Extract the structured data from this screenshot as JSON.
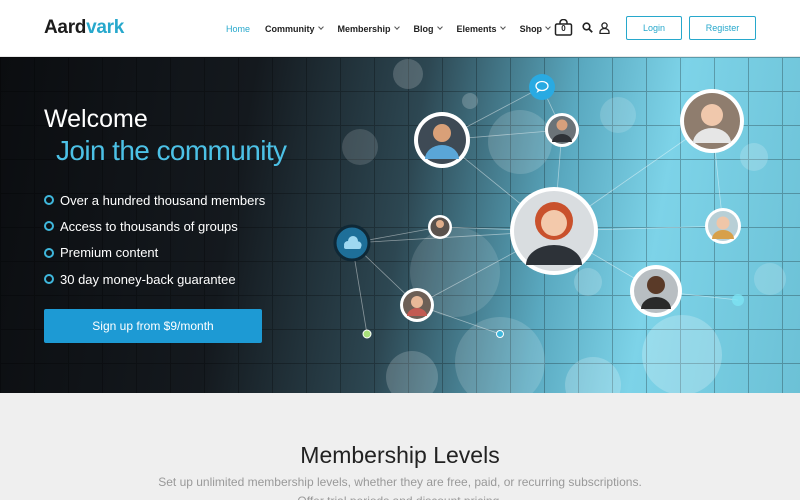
{
  "brand": {
    "part1": "Aard",
    "part2": "vark"
  },
  "nav": {
    "items": [
      {
        "label": "Home",
        "active": true,
        "dropdown": false
      },
      {
        "label": "Community",
        "dropdown": true
      },
      {
        "label": "Membership",
        "dropdown": true
      },
      {
        "label": "Blog",
        "dropdown": true
      },
      {
        "label": "Elements",
        "dropdown": true
      },
      {
        "label": "Shop",
        "dropdown": true
      }
    ],
    "cart_count": "0",
    "login_label": "Login",
    "register_label": "Register",
    "icons": [
      "cart-icon",
      "search-icon",
      "user-icon"
    ]
  },
  "hero": {
    "title": "Welcome",
    "subtitle": "Join the community",
    "features": [
      "Over a hundred thousand members",
      "Access to thousands of groups",
      "Premium content",
      "30 day money-back guarantee"
    ],
    "cta_label": "Sign up from $9/month",
    "icons": [
      "chat-bubble-icon",
      "cloud-icon"
    ]
  },
  "membership": {
    "title": "Membership Levels",
    "subtitle_line1": "Set up unlimited membership levels, whether they are free, paid, or recurring subscriptions.",
    "subtitle_line2": "Offer trial periods and discount pricing."
  },
  "colors": {
    "accent": "#27a8cc",
    "cta": "#1d9ad4",
    "hero_dark": "#0b0d10",
    "hero_light": "#7dd3e8",
    "section_bg": "#efefef"
  }
}
